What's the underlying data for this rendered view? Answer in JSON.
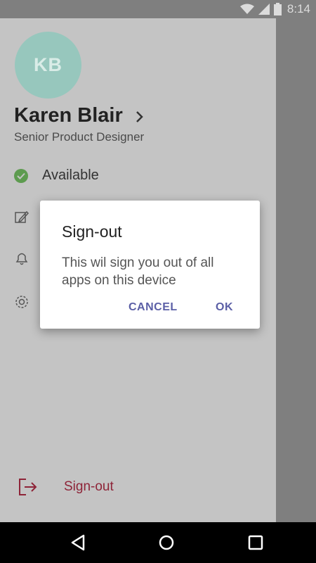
{
  "status_bar": {
    "time": "8:14"
  },
  "profile": {
    "initials": "KB",
    "name": "Karen Blair",
    "job_title": "Senior Product Designer",
    "avatar_color": "#97c7bd"
  },
  "menu": {
    "availability_label": "Available",
    "availability_color": "#5d9b4f"
  },
  "footer": {
    "signout_label": "Sign-out",
    "signout_color": "#8e2438"
  },
  "dialog": {
    "title": "Sign-out",
    "message": "This wil sign you out of all apps on this device",
    "cancel_label": "CANCEL",
    "ok_label": "OK",
    "button_color": "#5b5fa6"
  },
  "icons": [
    "wifi-icon",
    "signal-icon",
    "battery-icon",
    "chevron-right-icon",
    "status-check-icon",
    "edit-icon",
    "bell-icon",
    "gear-icon",
    "signout-icon",
    "back-icon",
    "home-icon",
    "recents-icon"
  ]
}
